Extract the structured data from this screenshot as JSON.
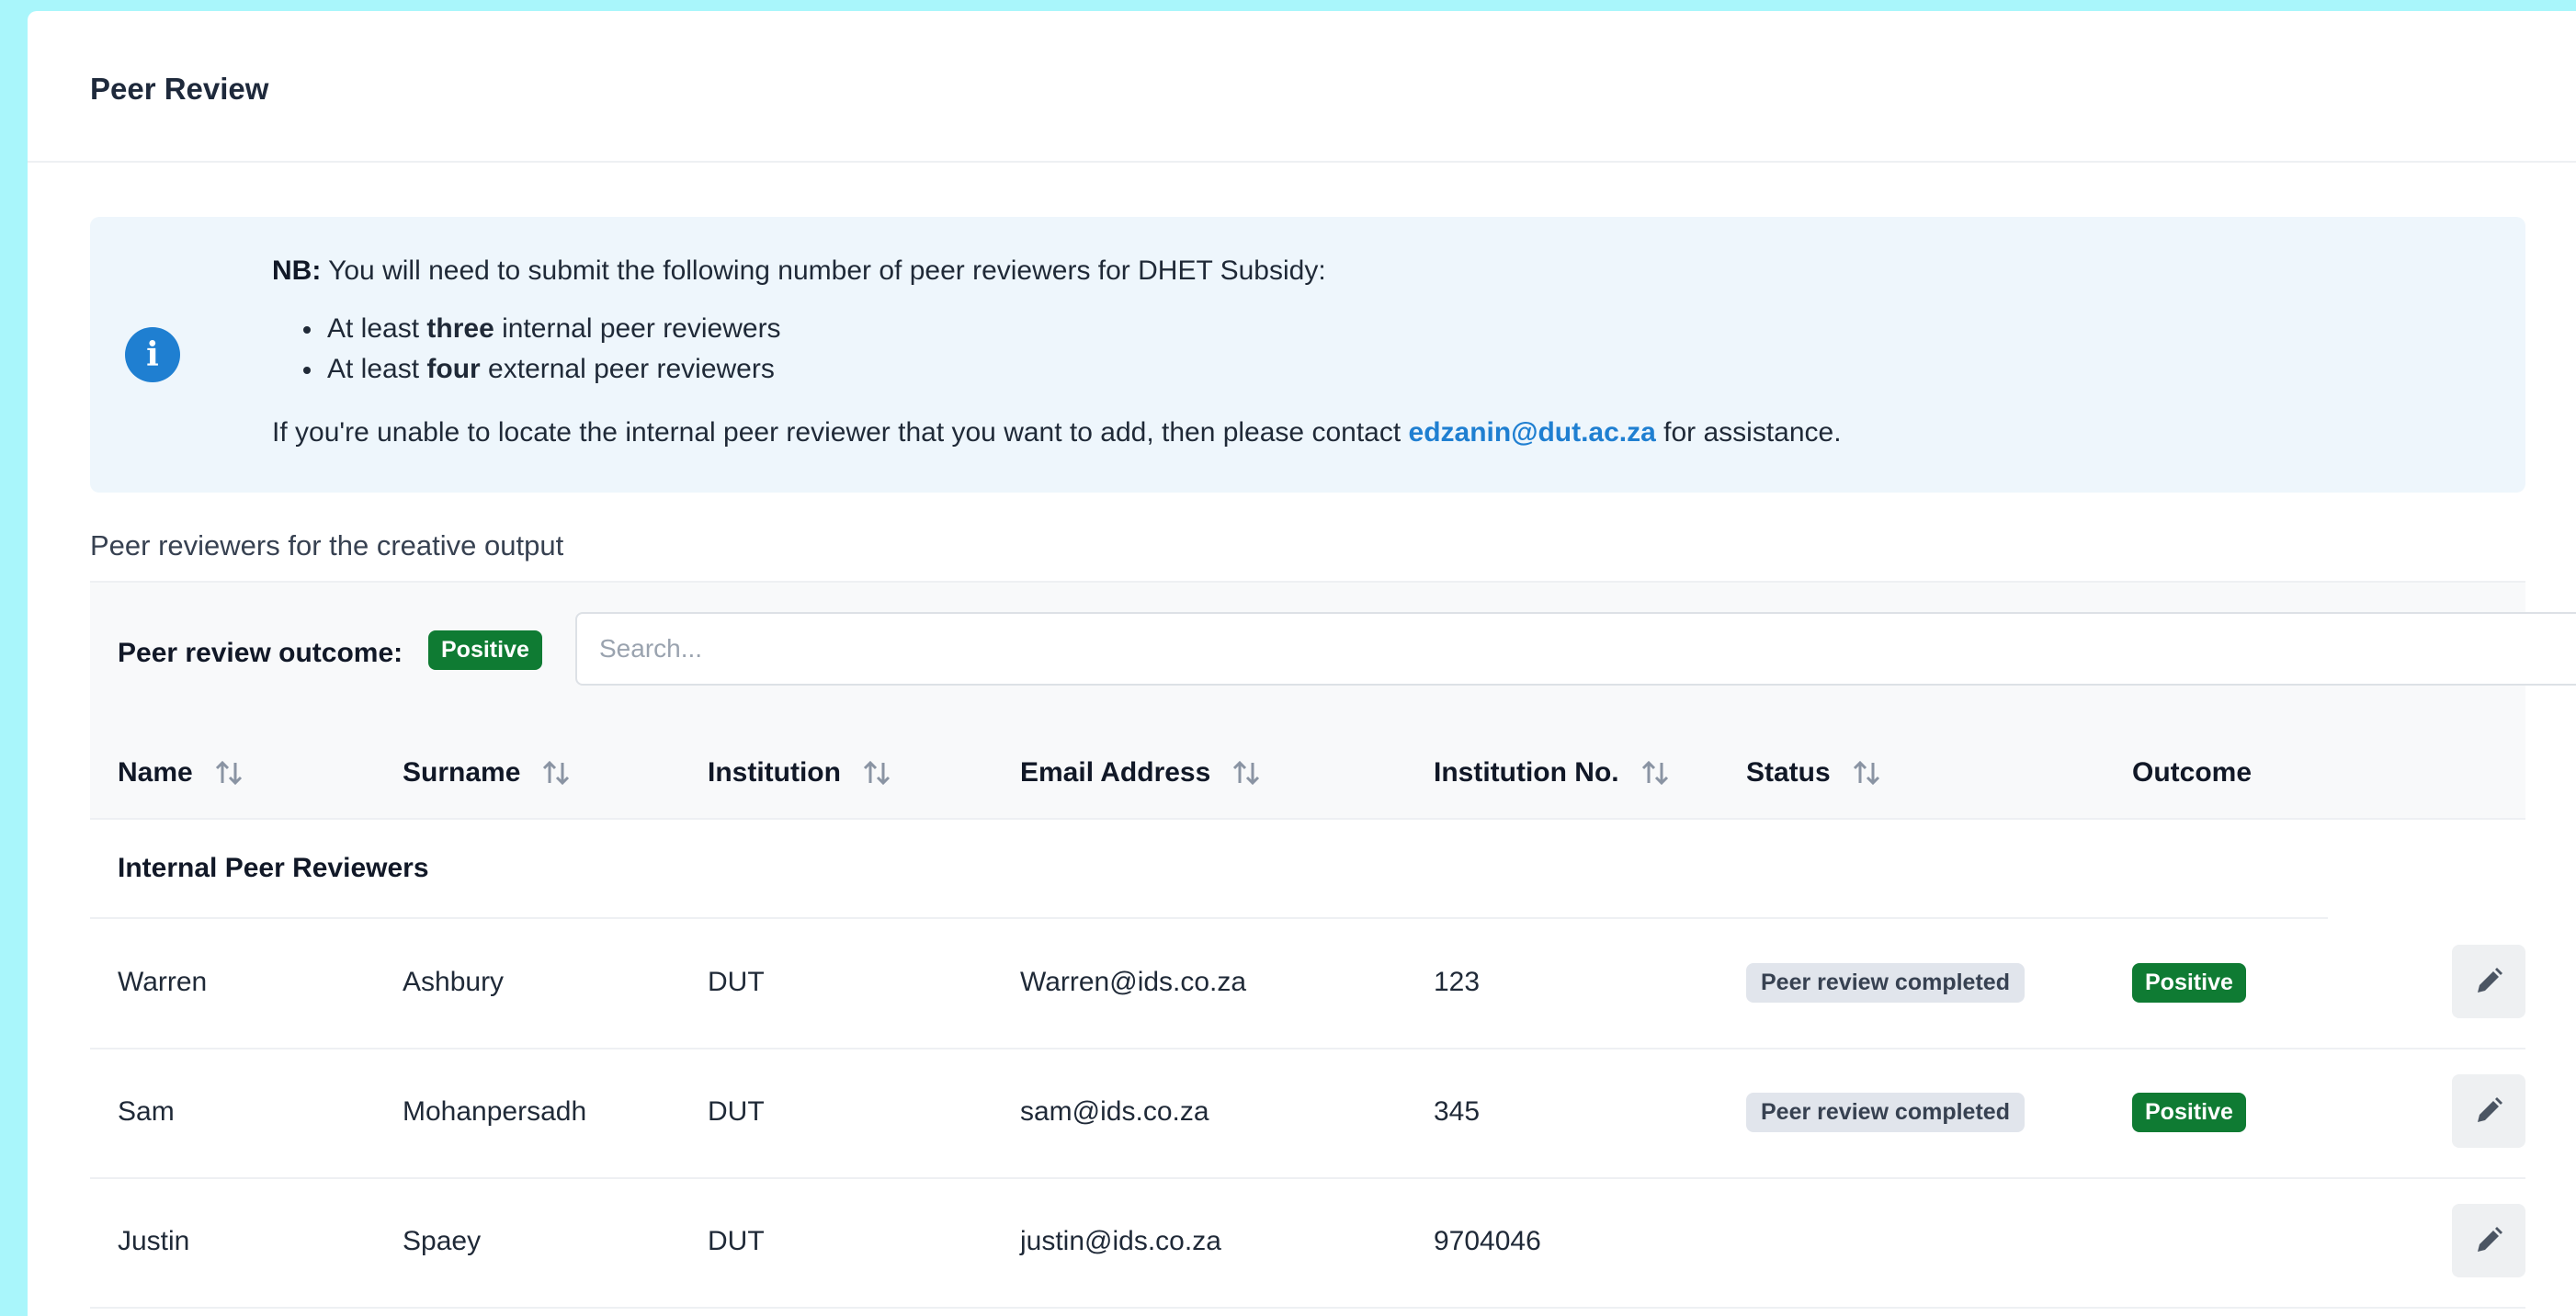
{
  "page": {
    "title": "Peer Review"
  },
  "info": {
    "nb_label": "NB:",
    "nb_text": " You will need to submit the following number of peer reviewers for DHET Subsidy:",
    "bullets": [
      {
        "prefix": "At least ",
        "bold": "three",
        "suffix": " internal peer reviewers"
      },
      {
        "prefix": "At least ",
        "bold": "four",
        "suffix": " external peer reviewers"
      }
    ],
    "contact_prefix": "If you're unable to locate the internal peer reviewer that you want to add, then please contact ",
    "contact_email": "edzanin@dut.ac.za",
    "contact_suffix": " for assistance.",
    "icon": "info-icon"
  },
  "section": {
    "caption": "Peer reviewers for the creative output"
  },
  "toolbar": {
    "outcome_label": "Peer review outcome:",
    "outcome_value": "Positive",
    "search_placeholder": "Search..."
  },
  "table": {
    "columns": [
      "Name",
      "Surname",
      "Institution",
      "Email Address",
      "Institution No.",
      "Status",
      "Outcome"
    ],
    "group_label": "Internal Peer Reviewers",
    "rows": [
      {
        "name": "Warren",
        "surname": "Ashbury",
        "institution": "DUT",
        "email": "Warren@ids.co.za",
        "inst_no": "123",
        "status": "Peer review completed",
        "outcome": "Positive"
      },
      {
        "name": "Sam",
        "surname": "Mohanpersadh",
        "institution": "DUT",
        "email": "sam@ids.co.za",
        "inst_no": "345",
        "status": "Peer review completed",
        "outcome": "Positive"
      },
      {
        "name": "Justin",
        "surname": "Spaey",
        "institution": "DUT",
        "email": "justin@ids.co.za",
        "inst_no": "9704046",
        "status": "",
        "outcome": ""
      }
    ]
  },
  "colors": {
    "accent": "#1f7fd1",
    "positive": "#0f7b33",
    "page_bg": "#a9f6fb"
  }
}
